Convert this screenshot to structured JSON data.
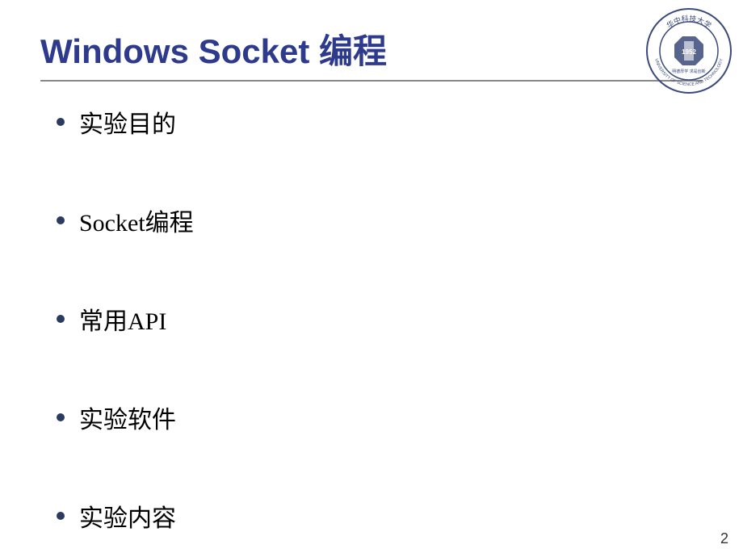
{
  "title": "Windows Socket 编程",
  "bullets": [
    "实验目的",
    "Socket编程",
    " 常用API",
    "实验软件",
    "实验内容"
  ],
  "logo": {
    "outer_text_top": "华中科技大学",
    "outer_text_bottom": "UNIVERSITY OF SCIENCE AND TECHNOLOGY"
  },
  "page_number": "2"
}
